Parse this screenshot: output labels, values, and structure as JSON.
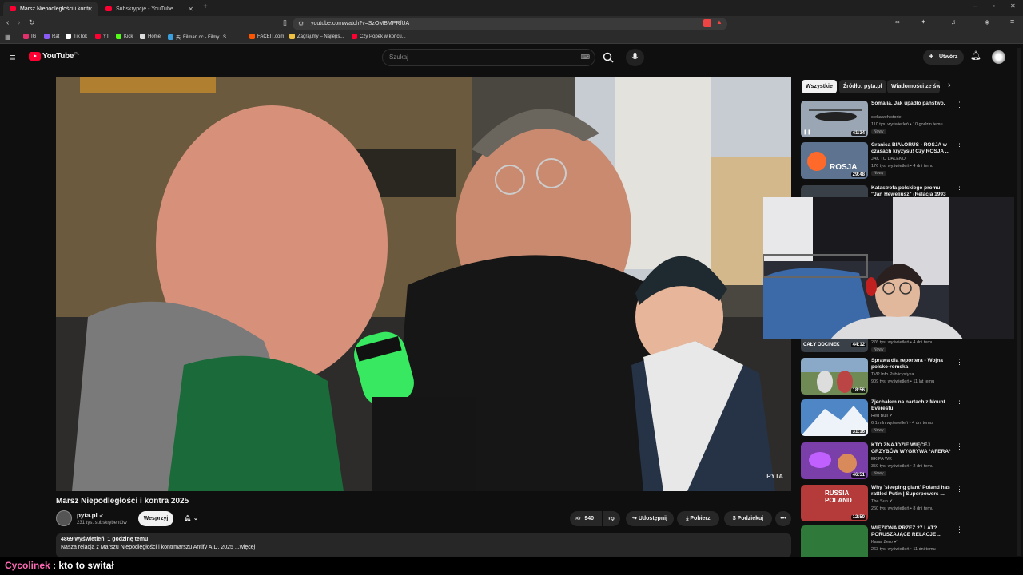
{
  "browser": {
    "tabs": [
      {
        "label": "Marsz Niepodległości i kontr",
        "active": true
      },
      {
        "label": "Subskrypcje - YouTube",
        "active": false
      }
    ],
    "url": "youtube.com/watch?v=SzOMBMPRfUA",
    "bookmarks": [
      {
        "label": "IG",
        "color": "#e1306c"
      },
      {
        "label": "Rat",
        "color": "#8a5cf5"
      },
      {
        "label": "TikTok",
        "color": "#ffffff"
      },
      {
        "label": "YT",
        "color": "#ff0033"
      },
      {
        "label": "Kick",
        "color": "#53fc18"
      },
      {
        "label": "Home",
        "color": "#dddddd"
      },
      {
        "label": "Filman.cc - Filmy i S...",
        "color": "#3aa0e0"
      },
      {
        "label": "FACEIT.com",
        "color": "#ff5500"
      },
      {
        "label": "Zagraj.my – Najleps...",
        "color": "#f0c040"
      },
      {
        "label": "Czy Popek w końcu...",
        "color": "#ff0033"
      }
    ]
  },
  "youtube": {
    "logo": "YouTube",
    "region": "PL",
    "search_placeholder": "Szukaj",
    "create_label": "Utwórz"
  },
  "video": {
    "title": "Marsz Niepodległości i kontra 2025",
    "watermark": "PYTA",
    "channel": {
      "name": "pyta.pl",
      "subscribers": "231 tys. subskrybentów"
    },
    "support_label": "Wesprzyj",
    "likes": "940",
    "share_label": "Udostępnij",
    "download_label": "Pobierz",
    "thanks_label": "Podziękuj",
    "views": "4869 wyświetleń",
    "time_ago": "1 godzinę temu",
    "description": "Nasza relacja z Marszu Niepodległości i kontrmarszu Antify A.D. 2025 ...więcej"
  },
  "sidebar": {
    "chips": [
      {
        "label": "Wszystkie",
        "selected": true
      },
      {
        "label": "Źródło: pyta.pl",
        "selected": false
      },
      {
        "label": "Wiadomości ze św",
        "selected": false
      }
    ],
    "recommendations": [
      {
        "title": "Somalia. Jak upadło państwo.",
        "channel": "ciekawehistorie",
        "meta": "110 tys. wyświetleń • 10 godzin temu",
        "badge": "Nowy",
        "duration": "41:34",
        "thumb_color": "#9aa6b4"
      },
      {
        "title": "Granica BIAŁORUŚ - ROSJA w czasach kryzysu! Czy ROSJA ...",
        "channel": "JAK TO DALEKO",
        "meta": "176 tys. wyświetleń • 4 dni temu",
        "badge": "Nowy",
        "duration": "29:48",
        "thumb_color": "#5e7390",
        "thumb_text": "ROSJA"
      },
      {
        "title": "Katastrofa polskiego promu \"Jan Heweliusz\" (Relacja 1993",
        "channel": "",
        "meta": "276 tys. wyświetleń • 4 dni temu",
        "badge": "Nowy",
        "duration": "44:12",
        "thumb_color": "#3a4048",
        "thumb_text": "CAŁY ODCINEK"
      },
      {
        "title": "Sprawa dla reportera - Wojna polsko-romska",
        "channel": "TVP Info Publicystyka",
        "meta": "909 tys. wyświetleń • 11 lat temu",
        "badge": "",
        "duration": "18:56",
        "thumb_color": "#6f8a55"
      },
      {
        "title": "Zjechałem na nartach z Mount Everestu",
        "channel": "Red Bull",
        "meta": "6,1 mln wyświetleń • 4 dni temu",
        "badge": "Nowy",
        "duration": "31:16",
        "thumb_color": "#4f86c6"
      },
      {
        "title": "KTO ZNAJDZIE WIĘCEJ GRZYBÓW WYGRYWA *AFERA*",
        "channel": "EKIPA WK",
        "meta": "359 tys. wyświetleń • 2 dni temu",
        "badge": "Nowy",
        "duration": "46:51",
        "thumb_color": "#7a3fa8"
      },
      {
        "title": "Why 'sleeping giant' Poland has rattled Putin | Superpowers ...",
        "channel": "The Sun",
        "meta": "260 tys. wyświetleń • 8 dni temu",
        "badge": "",
        "duration": "12:50",
        "thumb_color": "#b53a3a",
        "thumb_text": "RUSSIA POLAND"
      },
      {
        "title": "WIĘZIONA PRZEZ 27 LAT? PORUSZAJĄCE RELACJE ...",
        "channel": "Kanał Zero",
        "meta": "263 tys. wyświetleń • 11 dni temu",
        "badge": "",
        "duration": "",
        "thumb_color": "#2f7a3a"
      }
    ]
  },
  "chat": {
    "user": "Cycolinek",
    "separator": " : ",
    "message": "kto to switał",
    "user_color": "#ff69b4"
  }
}
